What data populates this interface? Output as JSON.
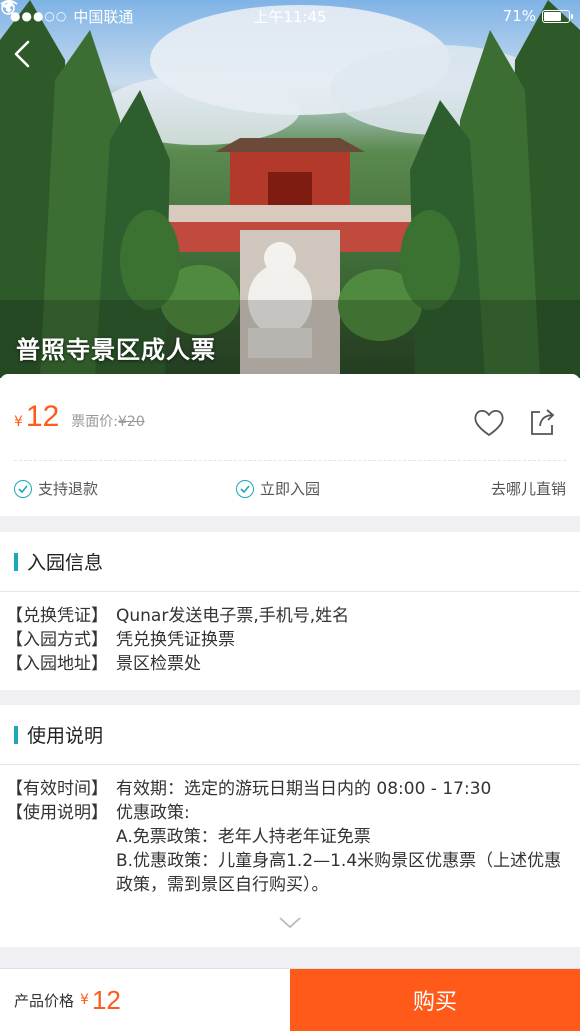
{
  "status_bar": {
    "carrier": "中国联通",
    "time": "上午11:45",
    "battery": "71%",
    "battery_level": 0.71
  },
  "hero": {
    "title": "普照寺景区成人票"
  },
  "price": {
    "currency": "¥",
    "value": "12",
    "face_label": "票面价:",
    "face_value": "¥20"
  },
  "features": [
    {
      "label": "支持退款"
    },
    {
      "label": "立即入园"
    },
    {
      "label": "去哪儿直销"
    }
  ],
  "entry_info": {
    "title": "入园信息",
    "rows": [
      {
        "key": "【兑换凭证】",
        "value": "Qunar发送电子票,手机号,姓名"
      },
      {
        "key": "【入园方式】",
        "value": "凭兑换凭证换票"
      },
      {
        "key": "【入园地址】",
        "value": "景区检票处"
      }
    ]
  },
  "usage": {
    "title": "使用说明",
    "valid_key": "【有效时间】",
    "valid_value": "有效期：选定的游玩日期当日内的 08:00 - 17:30",
    "desc_key": "【使用说明】",
    "desc_value": "优惠政策:",
    "line_a": "A.免票政策：老年人持老年证免票",
    "line_b": "B.优惠政策：儿童身高1.2—1.4米购景区优惠票（上述优惠政策，需到景区自行购买）。"
  },
  "bottom_bar": {
    "label": "产品价格",
    "currency": "¥",
    "price": "12",
    "buy_label": "购买"
  },
  "colors": {
    "accent": "#ff5a19",
    "teal": "#1ba9ba"
  }
}
